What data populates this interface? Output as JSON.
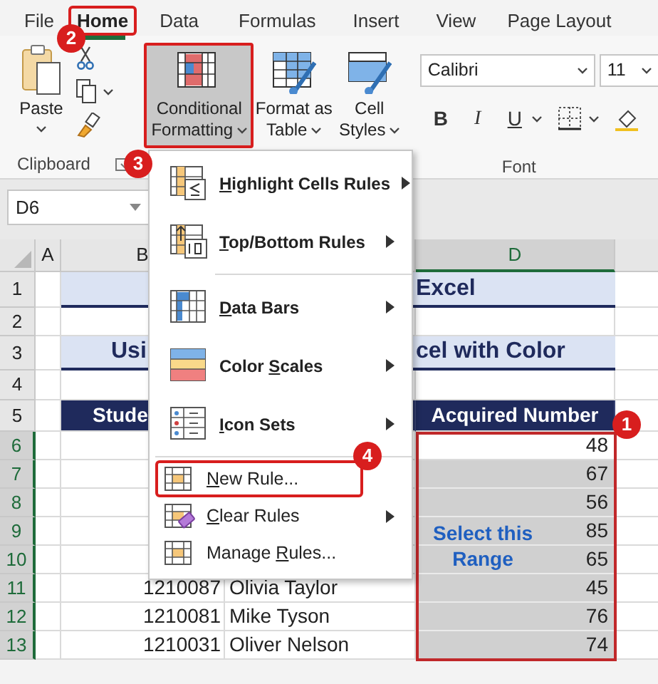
{
  "tabs": [
    {
      "label": "File",
      "selected": false,
      "highlighted": false
    },
    {
      "label": "Home",
      "selected": true,
      "highlighted": true
    },
    {
      "label": "Data",
      "selected": false,
      "highlighted": false
    },
    {
      "label": "Formulas",
      "selected": false,
      "highlighted": false
    },
    {
      "label": "Insert",
      "selected": false,
      "highlighted": false
    },
    {
      "label": "View",
      "selected": false,
      "highlighted": false
    },
    {
      "label": "Page Layout",
      "selected": false,
      "highlighted": false
    }
  ],
  "ribbon": {
    "clipboard": {
      "paste_label": "Paste",
      "group_label": "Clipboard"
    },
    "styles": [
      {
        "kind": "conditional",
        "label_lines": [
          "Conditional",
          "Formatting"
        ],
        "pressed": true,
        "highlighted": true
      },
      {
        "kind": "table",
        "label_lines": [
          "Format as",
          "Table"
        ],
        "pressed": false,
        "highlighted": false
      },
      {
        "kind": "cell-styles",
        "label_lines": [
          "Cell",
          "Styles"
        ],
        "pressed": false,
        "highlighted": false
      }
    ],
    "font": {
      "name": "Calibri",
      "size": "11",
      "format_buttons": [
        "B",
        "I",
        "U"
      ],
      "group_label": "Font"
    }
  },
  "name_box": "D6",
  "sheet": {
    "columns": [
      {
        "label": "A",
        "selected": false
      },
      {
        "label": "B",
        "selected": false
      },
      {
        "label": "D",
        "selected": true
      }
    ],
    "row_numbers": [
      {
        "label": "1",
        "selected": false
      },
      {
        "label": "2",
        "selected": false
      },
      {
        "label": "3",
        "selected": false
      },
      {
        "label": "4",
        "selected": false
      },
      {
        "label": "5",
        "selected": false
      },
      {
        "label": "6",
        "selected": true
      },
      {
        "label": "7",
        "selected": true
      },
      {
        "label": "8",
        "selected": true
      },
      {
        "label": "9",
        "selected": true
      },
      {
        "label": "10",
        "selected": true
      },
      {
        "label": "11",
        "selected": true
      },
      {
        "label": "12",
        "selected": true
      },
      {
        "label": "13",
        "selected": true
      }
    ],
    "title": "Excel",
    "subtitle_left": "Usi",
    "subtitle_right": "cel with Color",
    "header_left": "Stude",
    "header_right": "Acquired Number",
    "students": [
      {
        "id": "1210087",
        "name": "Olivia Taylor"
      },
      {
        "id": "1210081",
        "name": "Mike Tyson"
      },
      {
        "id": "1210031",
        "name": "Oliver Nelson"
      }
    ],
    "values": [
      {
        "text": "48",
        "active": true
      },
      {
        "text": "67",
        "active": false
      },
      {
        "text": "56",
        "active": false
      },
      {
        "text": "85",
        "active": false
      },
      {
        "text": "65",
        "active": false
      },
      {
        "text": "45",
        "active": false
      },
      {
        "text": "76",
        "active": false
      },
      {
        "text": "74",
        "active": false
      }
    ],
    "range_note": "Select this Range",
    "range_highlighted": true
  },
  "menu": {
    "groups": [
      {
        "large": true,
        "items": [
          {
            "kind": "highlight",
            "label": {
              "key": "H",
              "after": "ighlight Cells Rules"
            },
            "submenu": true,
            "highlighted": false
          },
          {
            "kind": "top-bottom",
            "label": {
              "key": "T",
              "after": "op/Bottom Rules"
            },
            "submenu": true,
            "highlighted": false
          }
        ]
      },
      {
        "large": true,
        "items": [
          {
            "kind": "data-bars",
            "label": {
              "key": "D",
              "after": "ata Bars"
            },
            "submenu": true,
            "highlighted": false
          },
          {
            "kind": "color-scales",
            "label": {
              "before": "Color ",
              "key": "S",
              "after": "cales"
            },
            "submenu": true,
            "highlighted": false
          },
          {
            "kind": "icon-sets",
            "label": {
              "key": "I",
              "after": "con Sets"
            },
            "submenu": true,
            "highlighted": false
          }
        ]
      },
      {
        "large": false,
        "items": [
          {
            "kind": "new-rule",
            "label": {
              "key": "N",
              "after": "ew Rule..."
            },
            "submenu": false,
            "highlighted": true
          },
          {
            "kind": "clear-rules",
            "label": {
              "key": "C",
              "after": "lear Rules"
            },
            "submenu": true,
            "highlighted": false
          },
          {
            "kind": "manage-rules",
            "label": {
              "before": "Manage ",
              "key": "R",
              "after": "ules..."
            },
            "submenu": false,
            "highlighted": false
          }
        ]
      }
    ]
  },
  "callouts": [
    {
      "number": "1"
    },
    {
      "number": "2"
    },
    {
      "number": "3"
    },
    {
      "number": "4"
    }
  ]
}
